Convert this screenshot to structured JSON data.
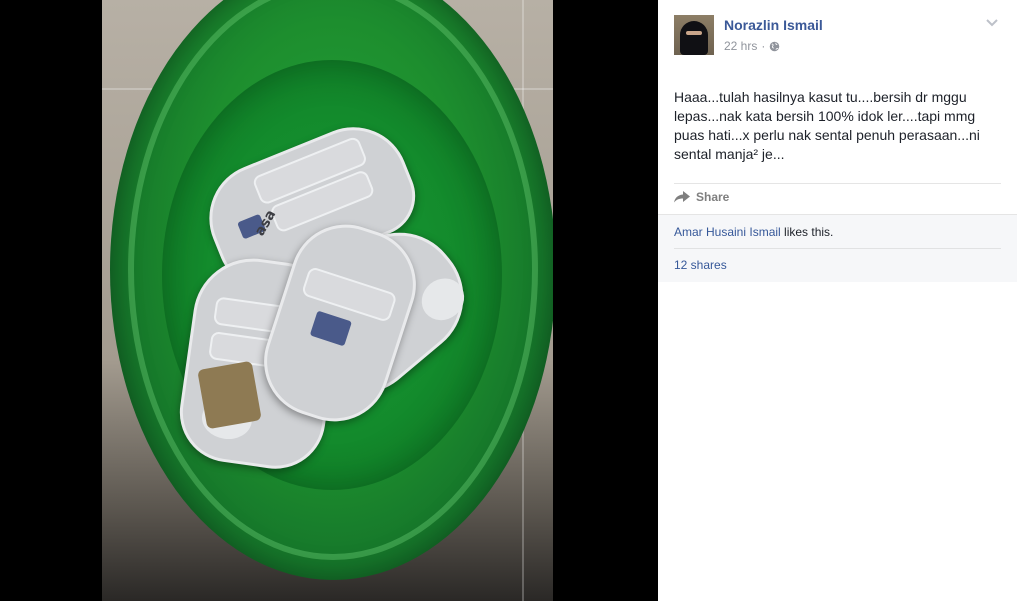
{
  "post": {
    "author": "Norazlin Ismail",
    "timestamp": "22 hrs",
    "separator": "·",
    "privacy_icon": "globe-icon",
    "text": "Haaa...tulah hasilnya kasut tu....bersih dr mggu lepas...nak kata bersih 100% idok ler....tapi mmg puas hati...x perlu nak sental penuh perasaan...ni sental manja² je...",
    "options_icon": "chevron-down-icon"
  },
  "actions": {
    "share_label": "Share",
    "share_icon": "share-arrow-icon"
  },
  "likes": {
    "liker_name": "Amar Husaini Ismail",
    "likes_suffix": "likes this.",
    "shares": "12 shares"
  },
  "photo": {
    "brand_text": "asa",
    "description_icon": "shoes-in-bowl-photo"
  },
  "colors": {
    "link_blue": "#3b5998",
    "meta_grey": "#90949c",
    "panel_bg": "#ffffff",
    "likes_bg": "#f6f7f9",
    "viewer_bg": "#000000"
  }
}
